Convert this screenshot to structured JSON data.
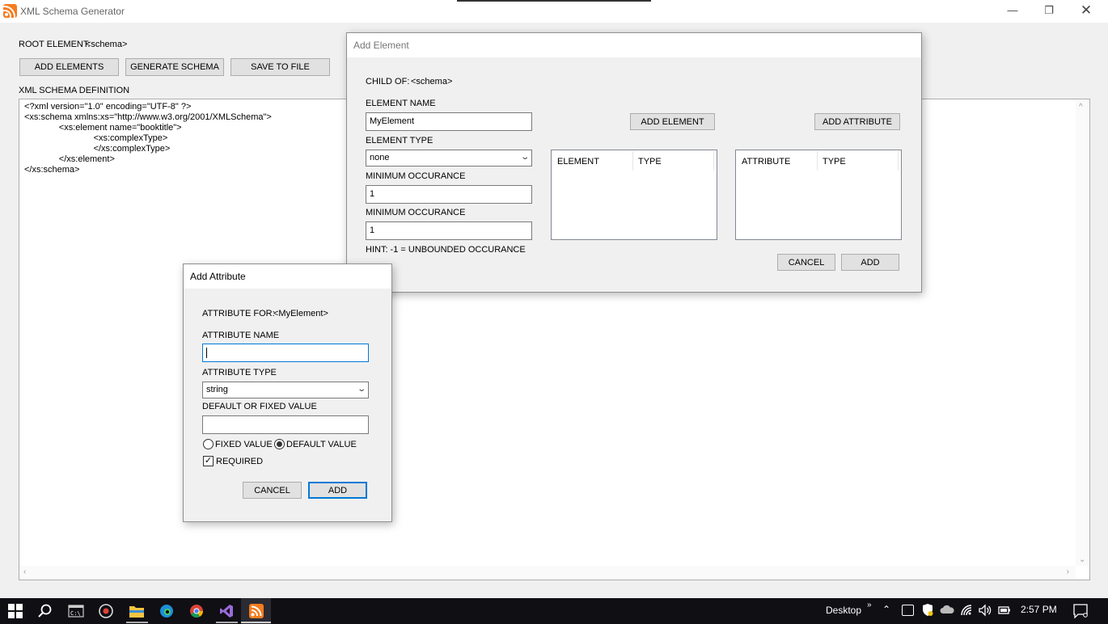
{
  "window": {
    "title": "XML Schema Generator"
  },
  "main": {
    "root_label": "ROOT ELEMENT:",
    "root_value": "<schema>",
    "buttons": {
      "add_elements": "ADD ELEMENTS",
      "generate": "GENERATE SCHEMA",
      "save": "SAVE TO FILE"
    },
    "definition_label": "XML SCHEMA DEFINITION",
    "schema_text": "<?xml version=\"1.0\" encoding=\"UTF-8\" ?>\n<xs:schema xmlns:xs=\"http://www.w3.org/2001/XMLSchema\">\n              <xs:element name=\"booktitle\">\n                            <xs:complexType>\n                            </xs:complexType>\n              </xs:element>\n</xs:schema>"
  },
  "add_element": {
    "title": "Add Element",
    "child_of_label": "CHILD OF:",
    "child_of_value": "<schema>",
    "element_name_label": "ELEMENT NAME",
    "element_name_value": "MyElement",
    "element_type_label": "ELEMENT TYPE",
    "element_type_value": "none",
    "min_occ_label": "MINIMUM OCCURANCE",
    "min_occ_value": "1",
    "max_occ_label": "MINIMUM OCCURANCE",
    "max_occ_value": "1",
    "hint": "HINT: -1 = UNBOUNDED OCCURANCE",
    "add_element_btn": "ADD ELEMENT",
    "add_attribute_btn": "ADD ATTRIBUTE",
    "element_list": {
      "col1": "ELEMENT",
      "col2": "TYPE"
    },
    "attribute_list": {
      "col1": "ATTRIBUTE",
      "col2": "TYPE"
    },
    "cancel": "CANCEL",
    "add": "ADD"
  },
  "add_attribute": {
    "title": "Add Attribute",
    "attribute_for_label": "ATTRIBUTE FOR:",
    "attribute_for_value": "<MyElement>",
    "name_label": "ATTRIBUTE NAME",
    "name_value": "",
    "type_label": "ATTRIBUTE TYPE",
    "type_value": "string",
    "default_label": "DEFAULT OR FIXED VALUE",
    "default_value": "",
    "fixed_radio": "FIXED VALUE",
    "fixed_selected": false,
    "default_radio": "DEFAULT VALUE",
    "default_selected": true,
    "required_label": "REQUIRED",
    "required_checked": true,
    "cancel": "CANCEL",
    "add": "ADD"
  },
  "taskbar": {
    "icons": [
      "windows-start-icon",
      "search-icon",
      "terminal-icon",
      "media-player-icon",
      "file-explorer-icon",
      "edge-icon",
      "chrome-icon",
      "visual-studio-icon",
      "rss-app-icon"
    ],
    "desktop_label": "Desktop",
    "clock": "2:57 PM"
  },
  "colors": {
    "focus_blue": "#0078d7",
    "rss_orange": "#f57c1f",
    "taskbar": "#0f0f14"
  }
}
